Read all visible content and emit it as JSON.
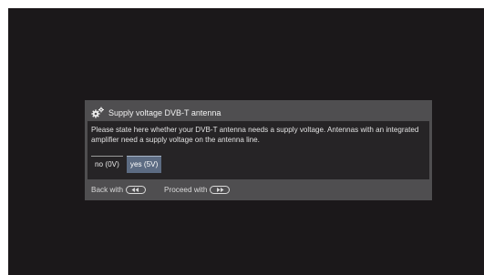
{
  "dialog": {
    "title": "Supply voltage DVB-T antenna",
    "title_icon": "gears-icon",
    "message": "Please state here whether your DVB-T antenna needs a supply voltage. Antennas with an integrated amplifier need a supply voltage on the antenna line.",
    "options": [
      {
        "label": "no (0V)",
        "selected": false
      },
      {
        "label": "yes (5V)",
        "selected": true
      }
    ],
    "footer": {
      "back_label": "Back with",
      "back_icon": "rewind-key-icon",
      "proceed_label": "Proceed with",
      "proceed_icon": "fast-forward-key-icon"
    }
  },
  "colors": {
    "screen_background": "#1b181a",
    "dialog_frame": "#4f4e50",
    "dialog_body": "#262426",
    "selected_option": "#5c6b82"
  }
}
